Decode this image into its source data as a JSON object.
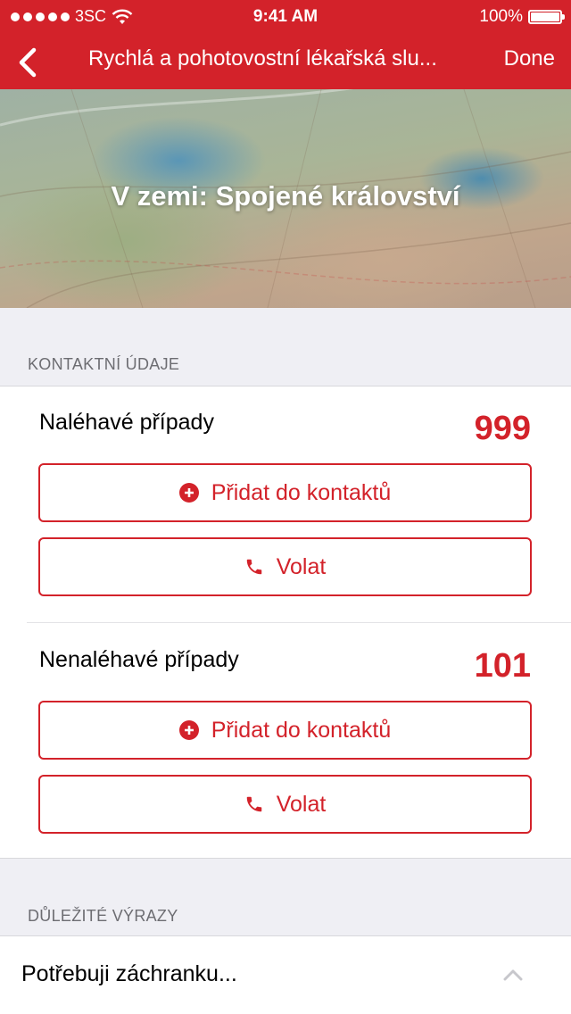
{
  "status": {
    "carrier": "3SC",
    "time": "9:41 AM",
    "battery": "100%",
    "battery_level": 1.0
  },
  "nav": {
    "back_icon": "chevron-left-icon",
    "title": "Rychlá a pohotovostní lékařská slu...",
    "done_label": "Done"
  },
  "hero": {
    "title": "V zemi: Spojené království"
  },
  "sections": {
    "contact_header": "KONTAKTNÍ ÚDAJE",
    "terms_header": "DŮLEŽITÉ VÝRAZY"
  },
  "contacts": [
    {
      "label": "Naléhavé případy",
      "number": "999",
      "add_label": "Přidat do kontaktů",
      "call_label": "Volat"
    },
    {
      "label": "Nenaléhavé případy",
      "number": "101",
      "add_label": "Přidat do kontaktů",
      "call_label": "Volat"
    }
  ],
  "terms": {
    "first_item": "Potřebuji záchranku..."
  },
  "colors": {
    "accent": "#d3222a",
    "background": "#efeff4"
  }
}
